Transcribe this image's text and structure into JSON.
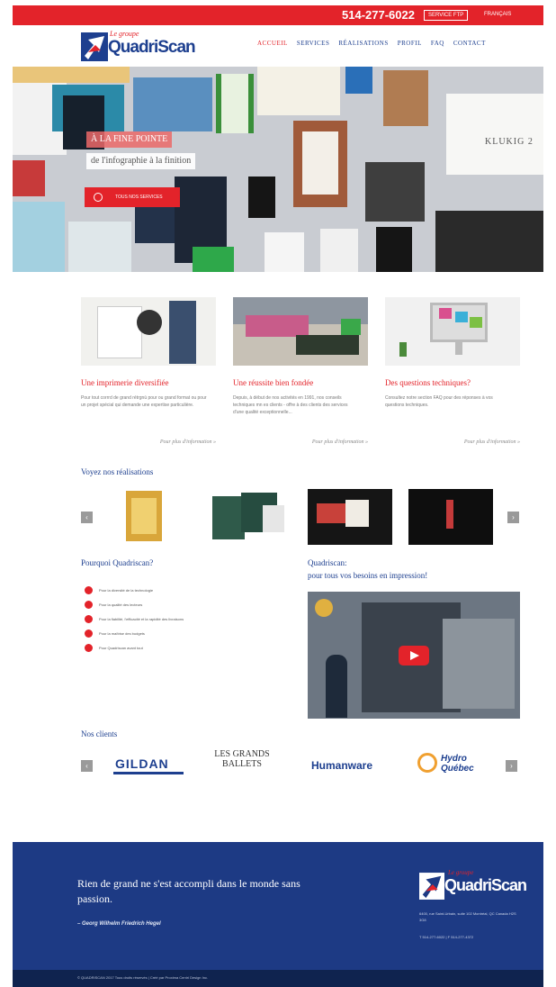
{
  "topbar": {
    "phone": "514-277-6022",
    "ftp_button": "SERVICE FTP",
    "language": "FRANÇAIS"
  },
  "header": {
    "logo_small": "Le groupe",
    "logo_big": "QuadriScan",
    "nav": [
      "ACCUEIL",
      "SERVICES",
      "RÉALISATIONS",
      "PROFIL",
      "FAQ",
      "CONTACT"
    ],
    "active_nav": "ACCUEIL"
  },
  "hero": {
    "caption_line1": "À LA FINE POINTE",
    "caption_line2": "de l'infographie à la finition",
    "button_label": "TOUS NOS SERVICES",
    "sign_text": "KLUKIG 2"
  },
  "features": [
    {
      "title": "Une imprimerie diversifiée",
      "text": "Pour tout corrrd de grand rétrgnù pour ou grand format ou pour un projet spécial qui demande une expertise particulière.",
      "more": "Pour plus d'information »"
    },
    {
      "title": "Une réussite bien fondée",
      "text": "Depuis, à début de nos activités en 1991, nos conseils techniques mn es clients - offre à des clients des services d'une qualité exceptionnelle...",
      "more": "Pour plus d'information »"
    },
    {
      "title": "Des questions techniques?",
      "text": "Consultez notre section FAQ pour des réponses à vos questions techniques.",
      "more": "Pour plus d'information »"
    }
  ],
  "realisations": {
    "title": "Voyez nos réalisations",
    "prev": "‹",
    "next": "›"
  },
  "why": {
    "title": "Pourquoi Quadriscan?",
    "items": [
      "Pour la diversité de la technologie",
      "Pour la qualité des lecteurs",
      "Pour la fiabilité, l'efficacité et la rapidité des livraisons",
      "Pour la maîtrise des budgets",
      "Pour Quadriscan avant tout"
    ]
  },
  "video_section": {
    "title_line1": "Quadriscan:",
    "title_line2": "pour tous vos besoins en impression!"
  },
  "clients": {
    "title": "Nos clients",
    "logos": [
      "GILDAN",
      "LES GRANDS BALLETS",
      "Humanware",
      "Hydro Québec"
    ],
    "prev": "‹",
    "next": "›"
  },
  "footer": {
    "quote": "Rien de grand ne s'est accompli dans le monde sans passion.",
    "author": "– Georg Wilhelm Friedrich Hegel",
    "logo_small": "Le groupe",
    "logo_big": "QuadriScan",
    "address": "6400, rue Saint-Urbain, suite 102 Montréal, QC Canada H2S 3G8",
    "phones": "T 514-277-6022 | F 514-277-4372",
    "copyright": "© QUADRISCAN 2017 Tous droits réservés | Créé par Proxima Centri Design Inc."
  },
  "colors": {
    "brand_red": "#e3232a",
    "brand_blue": "#1d3f8f",
    "footer_blue": "#1d3a84"
  }
}
